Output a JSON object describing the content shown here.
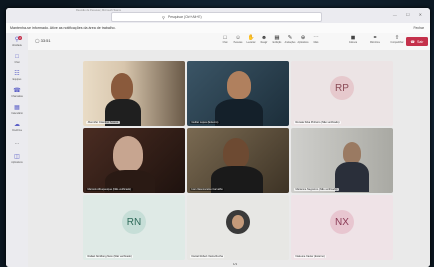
{
  "window": {
    "titlebar_text": "Reunião de Pessoas | Microsoft Teams",
    "search_placeholder": "Pesquisar (Ctrl+Alt+E)",
    "controls": "— ☐ ✕"
  },
  "banner": {
    "text": "Mantenha-se informado. Ative as notificações da área de trabalho.",
    "close_label": "Fechar"
  },
  "rail": {
    "items": [
      {
        "label": "Atividade",
        "icon": "bell-icon",
        "badge": "2"
      },
      {
        "label": "Chat",
        "icon": "chat-icon"
      },
      {
        "label": "Equipes",
        "icon": "teams-icon"
      },
      {
        "label": "Chamadas",
        "icon": "phone-icon"
      },
      {
        "label": "Calendário",
        "icon": "calendar-icon"
      },
      {
        "label": "OneDrive",
        "icon": "cloud-icon"
      },
      {
        "label": "...",
        "icon": "more-icon"
      },
      {
        "label": "Aplicativos",
        "icon": "apps-icon"
      }
    ]
  },
  "meeting": {
    "timer": "33:51",
    "toolbar": [
      {
        "label": "Chat",
        "icon": "chat-icon"
      },
      {
        "label": "Pessoas",
        "icon": "people-icon"
      },
      {
        "label": "Levantar",
        "icon": "hand-icon"
      },
      {
        "label": "Reagir",
        "icon": "react-icon"
      },
      {
        "label": "Exibição",
        "icon": "view-icon"
      },
      {
        "label": "Anotações",
        "icon": "notes-icon"
      },
      {
        "label": "Aplicativos",
        "icon": "apps-icon"
      },
      {
        "label": "Mais",
        "icon": "more-icon"
      },
      {
        "label": "Câmera",
        "icon": "camera-icon"
      },
      {
        "label": "Microfone",
        "icon": "mic-icon"
      },
      {
        "label": "Compartilhar",
        "icon": "share-icon"
      }
    ],
    "leave_label": "Sair"
  },
  "participants": [
    {
      "name": "Jhennifer Claudino Soares",
      "initials": ""
    },
    {
      "name": "Guilter Lopes (Externo)",
      "initials": ""
    },
    {
      "name": "Renata Silva Pinheiro (Não verificado)",
      "initials": "RP"
    },
    {
      "name": "Marcelo Albuquerque (Não verificado)",
      "initials": ""
    },
    {
      "name": "Ivan Vasconcelos Carvalho",
      "initials": ""
    },
    {
      "name": "Marianne Negreiros (Não verificado)",
      "initials": ""
    },
    {
      "name": "Rafael Nordberg Neto (Não verificado)",
      "initials": "RN"
    },
    {
      "name": "Daniel Robert Vieira Rocha",
      "initials": ""
    },
    {
      "name": "Natuune Xavier (Externo)",
      "initials": "NX"
    }
  ],
  "pager": "1/1",
  "colors": {
    "accent": "#5b5fc7",
    "leave": "#c4314b"
  }
}
